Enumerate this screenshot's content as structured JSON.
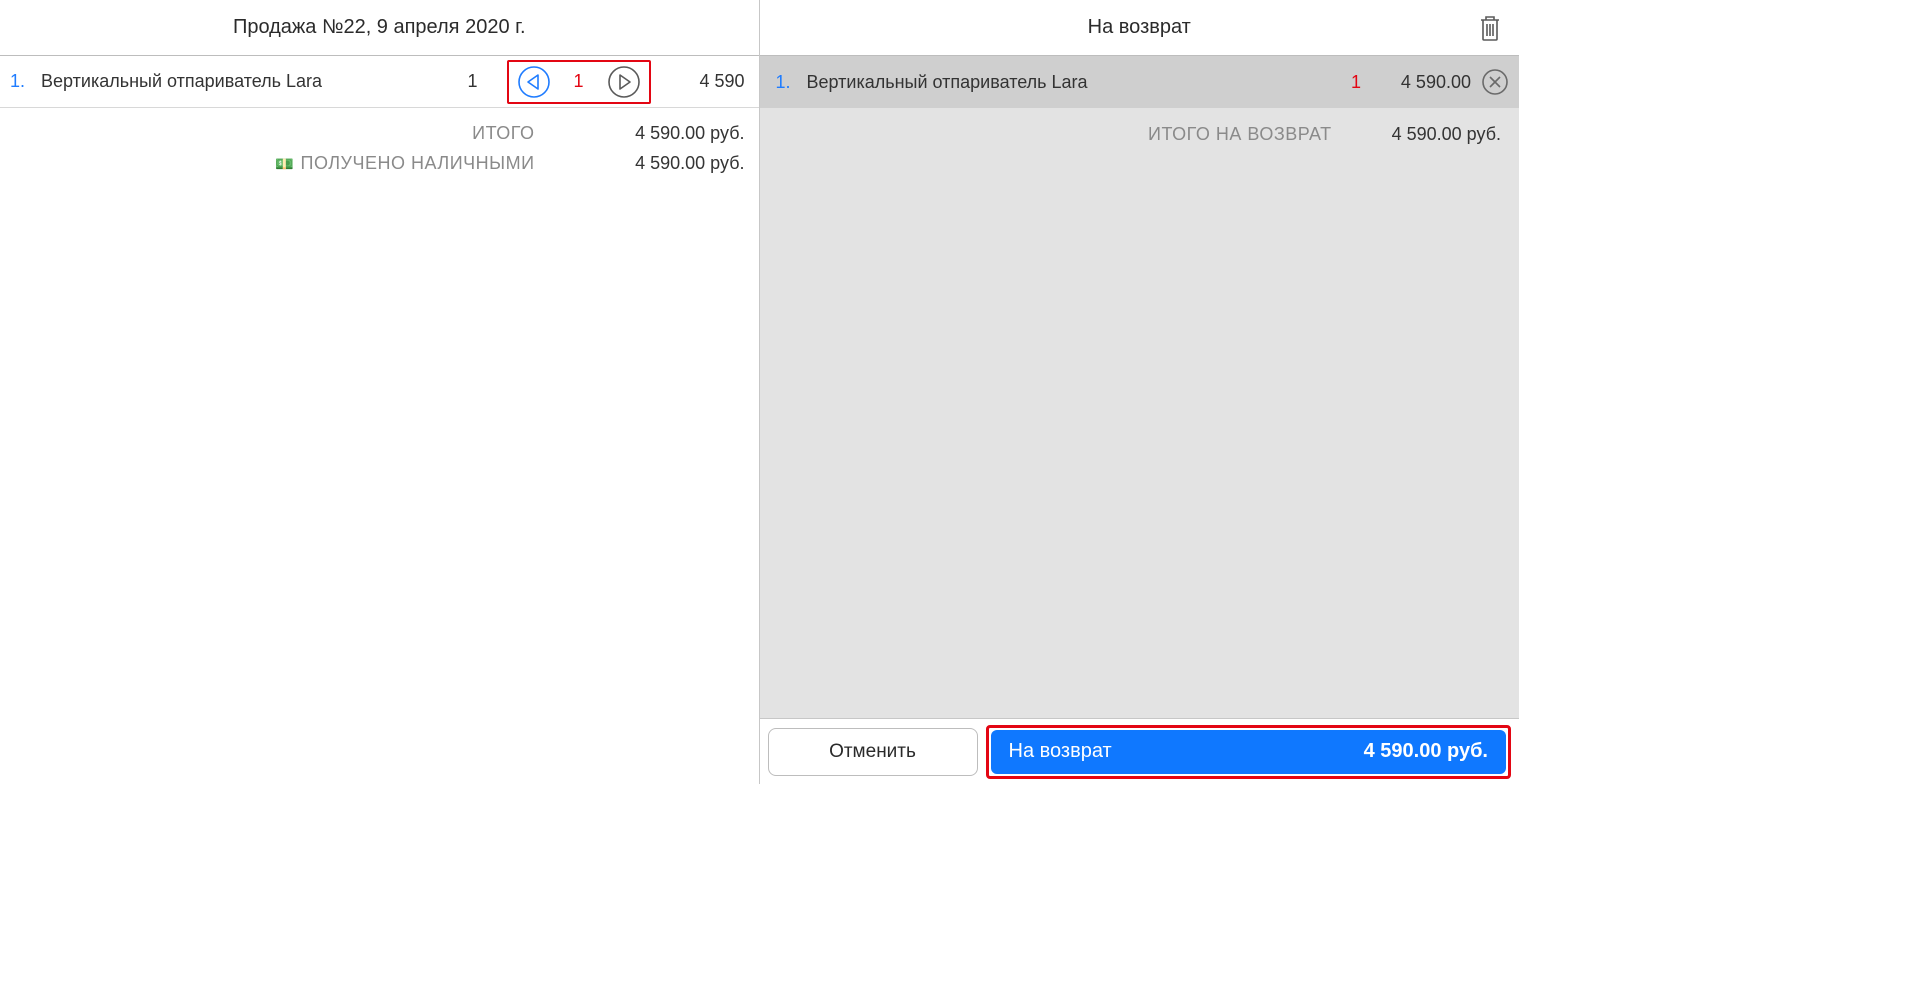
{
  "left": {
    "title": "Продажа №22, 9 апреля 2020 г.",
    "item": {
      "index": "1.",
      "name": "Вертикальный отпариватель Lara",
      "orig_qty": "1",
      "sel_qty": "1",
      "price": "4 590"
    },
    "totals": {
      "itogo_label": "ИТОГО",
      "itogo_value": "4 590.00 руб.",
      "cash_label": "ПОЛУЧЕНО НАЛИЧНЫМИ",
      "cash_value": "4 590.00 руб."
    }
  },
  "right": {
    "title": "На возврат",
    "item": {
      "index": "1.",
      "name": "Вертикальный отпариватель Lara",
      "qty": "1",
      "price": "4 590.00"
    },
    "totals": {
      "label": "ИТОГО НА ВОЗВРАТ",
      "value": "4 590.00 руб."
    },
    "footer": {
      "cancel": "Отменить",
      "return_label": "На возврат",
      "return_amount": "4 590.00 руб."
    }
  }
}
